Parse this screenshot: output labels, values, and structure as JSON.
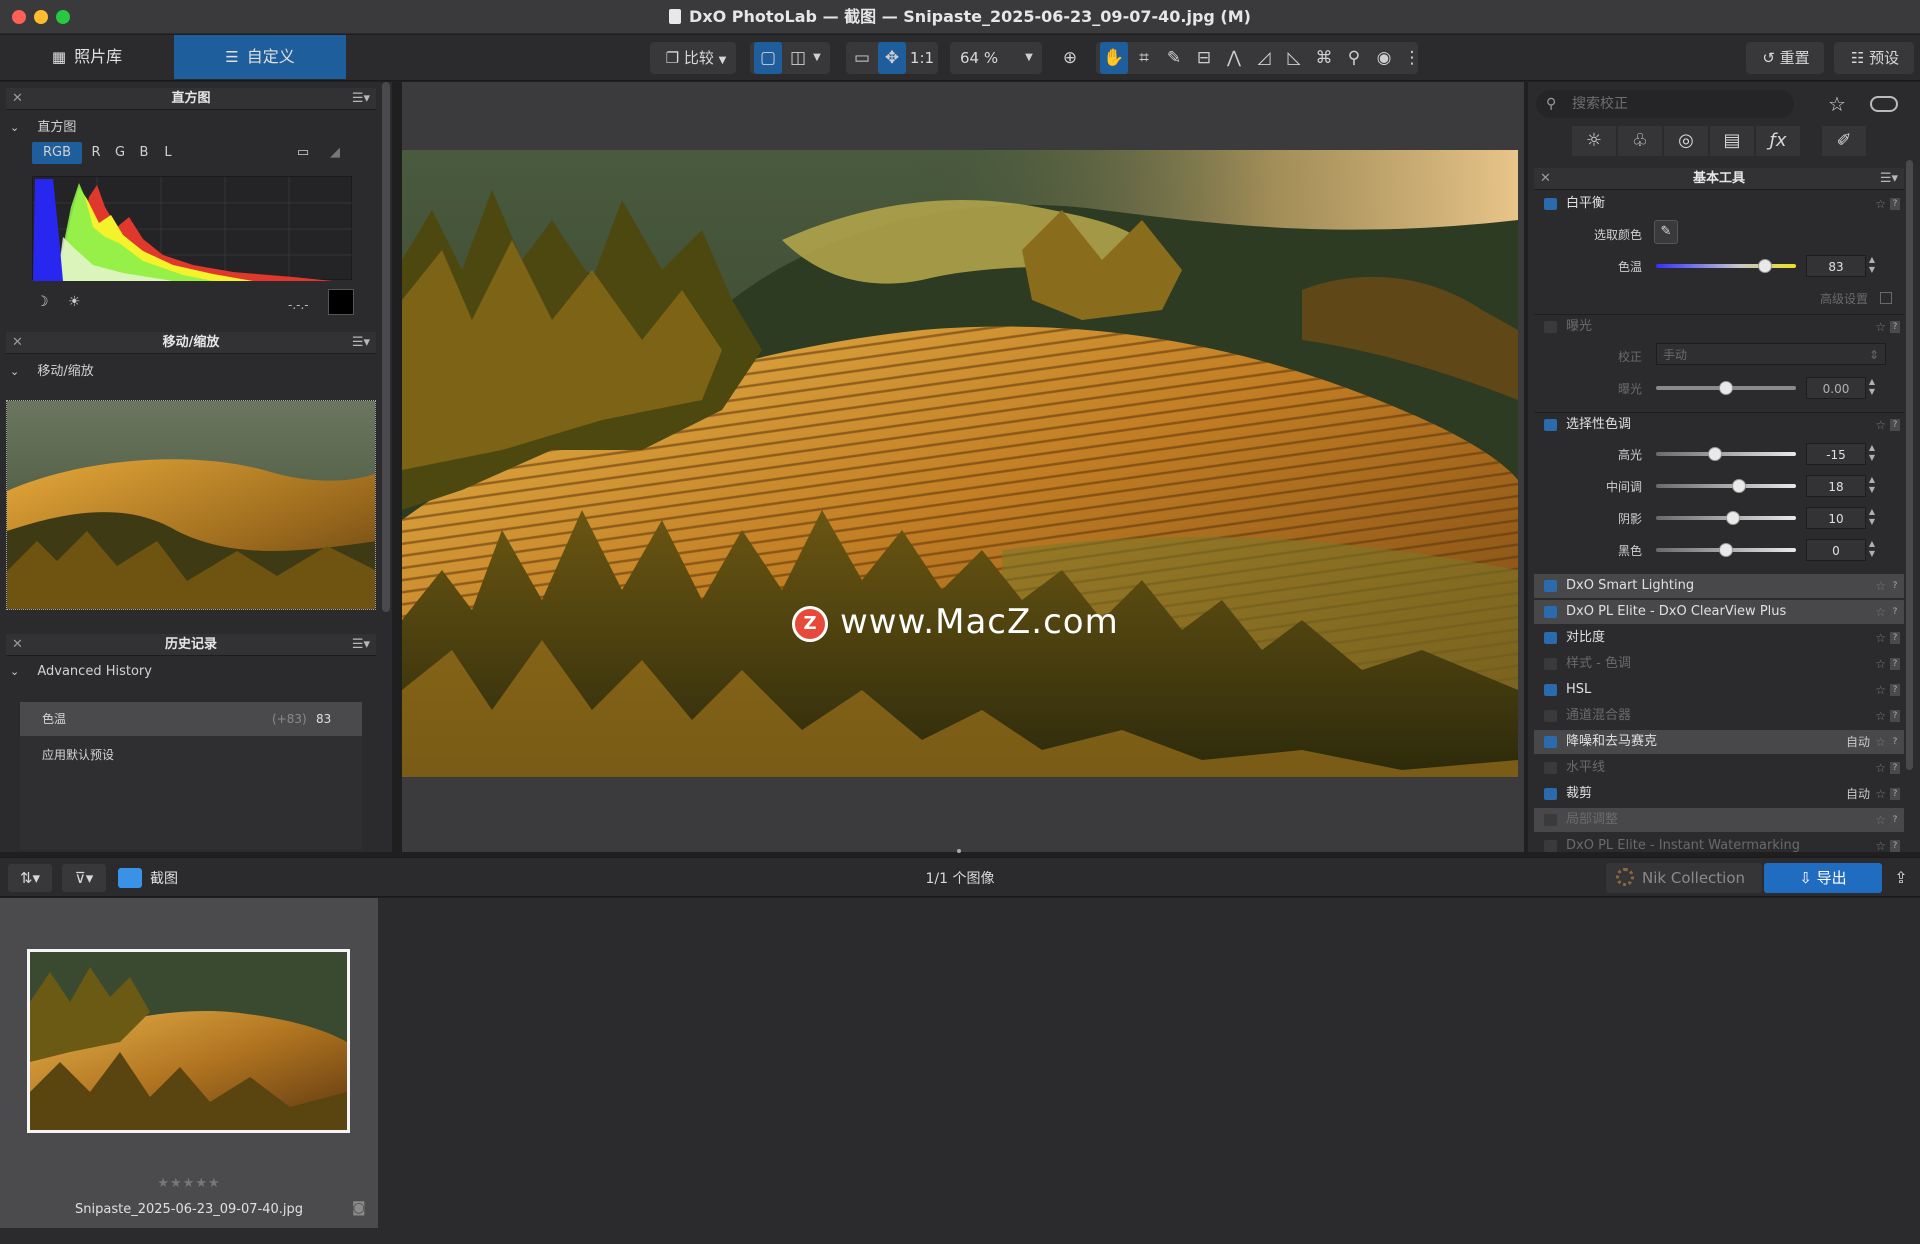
{
  "window": {
    "title": "DxO PhotoLab — 截图 — Snipaste_2025-06-23_09-07-40.jpg (M)"
  },
  "toolbar": {
    "library_tab": "照片库",
    "customize_tab": "自定义",
    "compare_label": "比较",
    "one_to_one": "1:1",
    "zoom": "64 %",
    "reset_label": "重置",
    "presets_label": "预设"
  },
  "left": {
    "histogram": {
      "title": "直方图",
      "sub": "直方图",
      "channels": [
        "RGB",
        "R",
        "G",
        "B",
        "L"
      ],
      "readout": "-.-.-"
    },
    "move_zoom": {
      "title": "移动/缩放",
      "sub": "移动/缩放"
    },
    "history": {
      "title": "历史记录",
      "sub": "Advanced History",
      "rows": [
        {
          "name": "色温",
          "delta": "(+83)",
          "value": "83"
        },
        {
          "name": "应用默认预设",
          "delta": "",
          "value": ""
        }
      ]
    }
  },
  "viewer": {
    "watermark": "www.MacZ.com"
  },
  "right": {
    "search_placeholder": "搜索校正",
    "section_title": "基本工具",
    "white_balance": {
      "title": "白平衡",
      "pick_color": "选取颜色",
      "temp_label": "色温",
      "temp_value": "83",
      "temp_level": 0.78,
      "advanced": "高级设置"
    },
    "exposure": {
      "title": "曝光",
      "correction_label": "校正",
      "correction_value": "手动",
      "exposure_label": "曝光",
      "exposure_value": "0.00",
      "exposure_level": 0.5
    },
    "selective_tone": {
      "title": "选择性色调",
      "sliders": [
        {
          "label": "高光",
          "value": "-15",
          "level": 0.42
        },
        {
          "label": "中间调",
          "value": "18",
          "level": 0.59
        },
        {
          "label": "阴影",
          "value": "10",
          "level": 0.55
        },
        {
          "label": "黑色",
          "value": "0",
          "level": 0.5
        }
      ]
    },
    "tools": [
      {
        "name": "DxO Smart Lighting",
        "right": "",
        "enabled": true,
        "highlight": true
      },
      {
        "name": "DxO PL Elite - DxO ClearView Plus",
        "right": "",
        "enabled": true,
        "highlight": true
      },
      {
        "name": "对比度",
        "right": "",
        "enabled": true,
        "highlight": false
      },
      {
        "name": "样式 - 色调",
        "right": "",
        "enabled": false,
        "highlight": false
      },
      {
        "name": "HSL",
        "right": "",
        "enabled": true,
        "highlight": false
      },
      {
        "name": "通道混合器",
        "right": "",
        "enabled": false,
        "highlight": false
      },
      {
        "name": "降噪和去马赛克",
        "right": "自动",
        "enabled": true,
        "highlight": true
      },
      {
        "name": "水平线",
        "right": "",
        "enabled": false,
        "highlight": false
      },
      {
        "name": "裁剪",
        "right": "自动",
        "enabled": true,
        "highlight": false
      },
      {
        "name": "局部调整",
        "right": "",
        "enabled": false,
        "highlight": true
      },
      {
        "name": "DxO PL Elite - Instant Watermarking",
        "right": "",
        "enabled": false,
        "highlight": false
      }
    ]
  },
  "bottom": {
    "folder": "截图",
    "count": "1/1 个图像",
    "nik": "Nik Collection",
    "export": "导出"
  },
  "filmstrip": {
    "filename": "Snipaste_2025-06-23_09-07-40.jpg",
    "stars": "★★★★★"
  },
  "colors": {
    "accent": "#1f5e9c",
    "panel": "#2b2b2d"
  }
}
